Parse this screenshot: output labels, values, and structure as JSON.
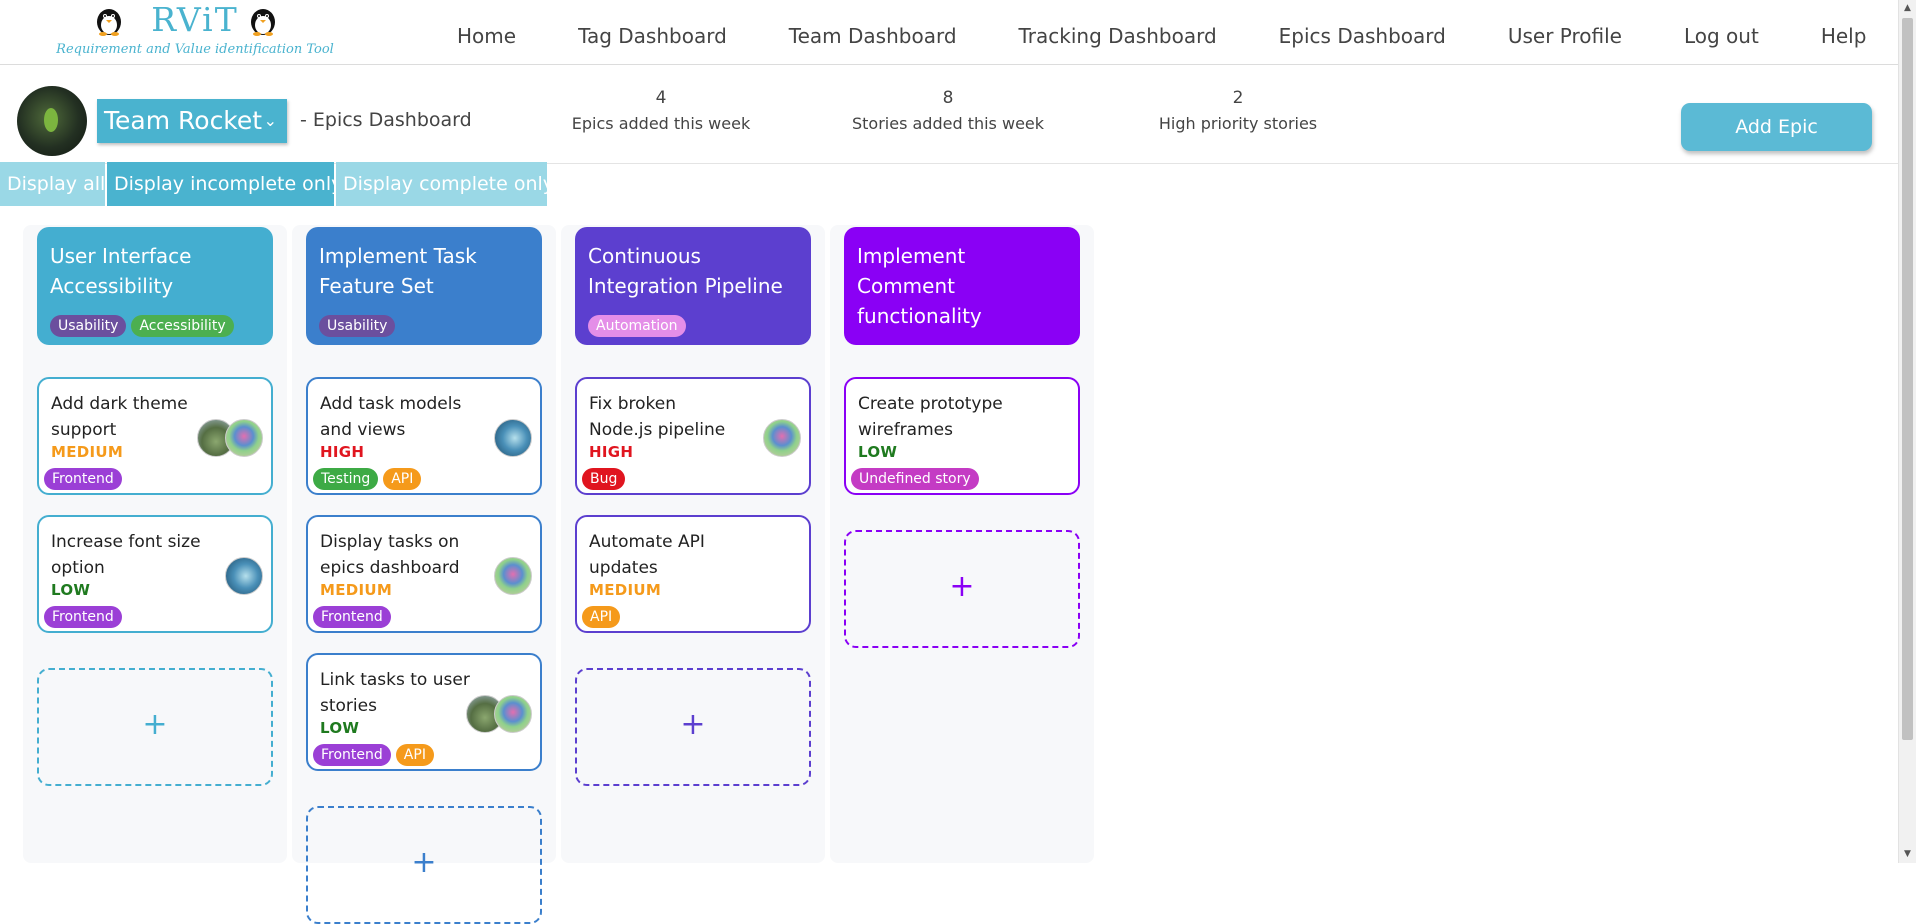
{
  "logo": {
    "title": "RViT",
    "subtitle": "Requirement and Value identification Tool"
  },
  "nav": {
    "home": "Home",
    "tag_dashboard": "Tag Dashboard",
    "team_dashboard": "Team Dashboard",
    "tracking_dashboard": "Tracking Dashboard",
    "epics_dashboard": "Epics Dashboard",
    "user_profile": "User Profile",
    "log_out": "Log out",
    "help": "Help"
  },
  "header": {
    "team_name": "Team Rocket",
    "page_title": "- Epics Dashboard",
    "stats": [
      {
        "value": "4",
        "label": "Epics added this week"
      },
      {
        "value": "8",
        "label": "Stories added this week"
      },
      {
        "value": "2",
        "label": "High priority stories"
      }
    ],
    "add_epic_label": "Add Epic"
  },
  "filters": {
    "display_all": "Display all",
    "display_incomplete": "Display incomplete only",
    "display_complete": "Display complete only",
    "active": "display_incomplete"
  },
  "colors": {
    "accent": "#4ab3cf",
    "epic1": "#44aed0",
    "epic2": "#3b7fcc",
    "epic3": "#5c3fcf",
    "epic4": "#8a00f5",
    "priority_high": "#e0151f",
    "priority_medium": "#f59a1b",
    "priority_low": "#1f7a1f",
    "tag_usability": "#6b4f9e",
    "tag_accessibility": "#4caf50",
    "tag_automation": "#e48ee8",
    "tag_frontend": "#9b3fd6",
    "tag_testing": "#3daa45",
    "tag_api": "#f59a1b",
    "tag_bug": "#e0151f",
    "tag_undefined": "#c43bc4"
  },
  "epics": [
    {
      "title": "User Interface Accessibility",
      "tags": [
        "Usability",
        "Accessibility"
      ],
      "stories": [
        {
          "title": "Add dark theme support",
          "priority": "MEDIUM",
          "tags": [
            "Frontend"
          ],
          "avatars": [
            "forest",
            "balloon"
          ]
        },
        {
          "title": "Increase font size option",
          "priority": "LOW",
          "tags": [
            "Frontend"
          ],
          "avatars": [
            "ice"
          ]
        }
      ]
    },
    {
      "title": "Implement Task Feature Set",
      "tags": [
        "Usability"
      ],
      "stories": [
        {
          "title": "Add task models and views",
          "priority": "HIGH",
          "tags": [
            "Testing",
            "API"
          ],
          "avatars": [
            "ice"
          ]
        },
        {
          "title": "Display tasks on epics dashboard",
          "priority": "MEDIUM",
          "tags": [
            "Frontend"
          ],
          "avatars": [
            "balloon"
          ]
        },
        {
          "title": "Link tasks to user stories",
          "priority": "LOW",
          "tags": [
            "Frontend",
            "API"
          ],
          "avatars": [
            "forest",
            "balloon"
          ]
        }
      ]
    },
    {
      "title": "Continuous Integration Pipeline",
      "tags": [
        "Automation"
      ],
      "stories": [
        {
          "title": "Fix broken Node.js pipeline",
          "priority": "HIGH",
          "tags": [
            "Bug"
          ],
          "avatars": [
            "balloon"
          ]
        },
        {
          "title": "Automate API updates",
          "priority": "MEDIUM",
          "tags": [
            "API"
          ],
          "avatars": []
        }
      ]
    },
    {
      "title": "Implement Comment functionality",
      "tags": [],
      "stories": [
        {
          "title": "Create prototype wireframes",
          "priority": "LOW",
          "tags": [
            "Undefined story"
          ],
          "avatars": []
        }
      ]
    }
  ],
  "add_story_symbol": "+"
}
